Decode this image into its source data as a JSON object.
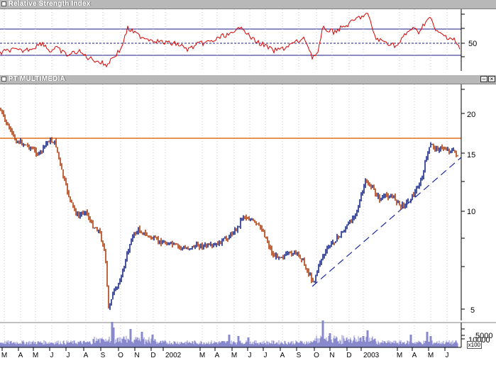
{
  "rsi_panel": {
    "title": "Relative Strength Index",
    "axis_label": "50"
  },
  "price_panel": {
    "title": "PT MULTIMEDIA",
    "axis_labels": [
      "20",
      "15",
      "10",
      "5"
    ]
  },
  "volume_panel": {
    "axis_labels": [
      "10000",
      "5000"
    ],
    "multiplier": "x100"
  },
  "x_axis": {
    "labels": [
      "M",
      "A",
      "M",
      "J",
      "J",
      "A",
      "S",
      "O",
      "N",
      "D",
      "2002",
      "M",
      "A",
      "M",
      "J",
      "J",
      "A",
      "S",
      "O",
      "N",
      "D",
      "2003",
      "M",
      "A",
      "M",
      "J"
    ]
  },
  "colors": {
    "rsi_line": "#dd0000",
    "resistance": "#e07020",
    "trend": "#1a2aa0",
    "candle_up": "#1a2a8a",
    "candle_down": "#b04010",
    "volume": "#8888cc"
  }
}
